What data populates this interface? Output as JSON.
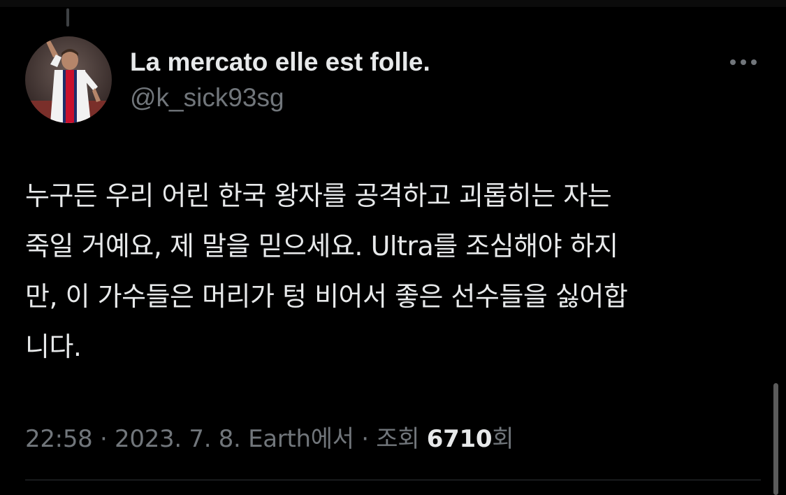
{
  "tweet": {
    "author": {
      "display_name": "La mercato elle est folle.",
      "handle": "@k_sick93sg",
      "avatar_icon": "avatar-photo"
    },
    "more_icon": "more-horizontal-icon",
    "text_lines": [
      "누구든 우리 어린 한국 왕자를 공격하고 괴롭히는 자는",
      "죽일 거예요, 제 말을 믿으세요. Ultra를 조심해야 하지",
      "만, 이 가수들은 머리가 텅 비어서 좋은 선수들을 싫어합",
      "니다."
    ],
    "meta": {
      "time": "22:58",
      "separator": "·",
      "date": "2023. 7. 8.",
      "source": "Earth에서",
      "views_label": "조회",
      "views_count": "6710",
      "views_suffix": "회"
    }
  },
  "colors": {
    "background": "#000000",
    "text_primary": "#e7e9ea",
    "text_secondary": "#71767b",
    "divider": "#2f3336"
  }
}
